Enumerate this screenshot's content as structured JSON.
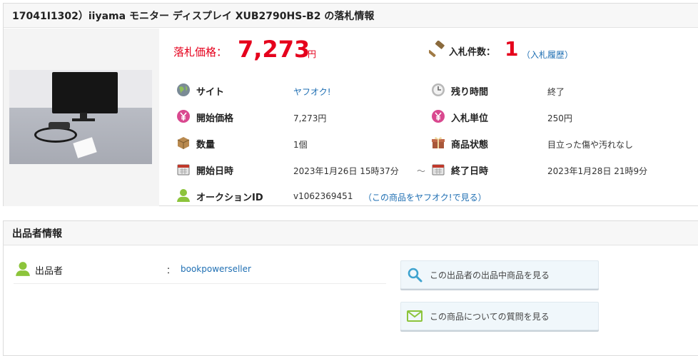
{
  "item": {
    "title": "17041I1302）iiyama モニター ディスプレイ XUB2790HS-B2 の落札情報",
    "price_label": "落札価格：",
    "price_value": "7,273",
    "price_unit": "円",
    "bid_count_label": "入札件数：",
    "bid_count_value": "1",
    "bid_history_link": "（入札履歴）",
    "rows": {
      "site_label": "サイト",
      "site_value": "ヤフオク!",
      "remaining_label": "残り時間",
      "remaining_value": "終了",
      "start_price_label": "開始価格",
      "start_price_value": "7,273円",
      "bid_unit_label": "入札単位",
      "bid_unit_value": "250円",
      "quantity_label": "数量",
      "quantity_value": "1個",
      "condition_label": "商品状態",
      "condition_value": "目立った傷や汚れなし",
      "start_date_label": "開始日時",
      "start_date_value": "2023年1月26日 15時37分",
      "date_separator": "～",
      "end_date_label": "終了日時",
      "end_date_value": "2023年1月28日 21時9分",
      "auction_id_label": "オークションID",
      "auction_id_value": "v1062369451",
      "auction_link": "（この商品をヤフオク!で見る）"
    }
  },
  "seller": {
    "header": "出品者情報",
    "label": "出品者",
    "colon": "：",
    "name": "bookpowerseller",
    "view_items_button": "この出品者の出品中商品を見る",
    "ask_question_button": "この商品についての質問を見る"
  },
  "colors": {
    "accent_red": "#e5001c",
    "link_blue": "#1f6fb3",
    "yen_icon_pink": "#d9488f",
    "seller_icon_green": "#8cc43b"
  }
}
